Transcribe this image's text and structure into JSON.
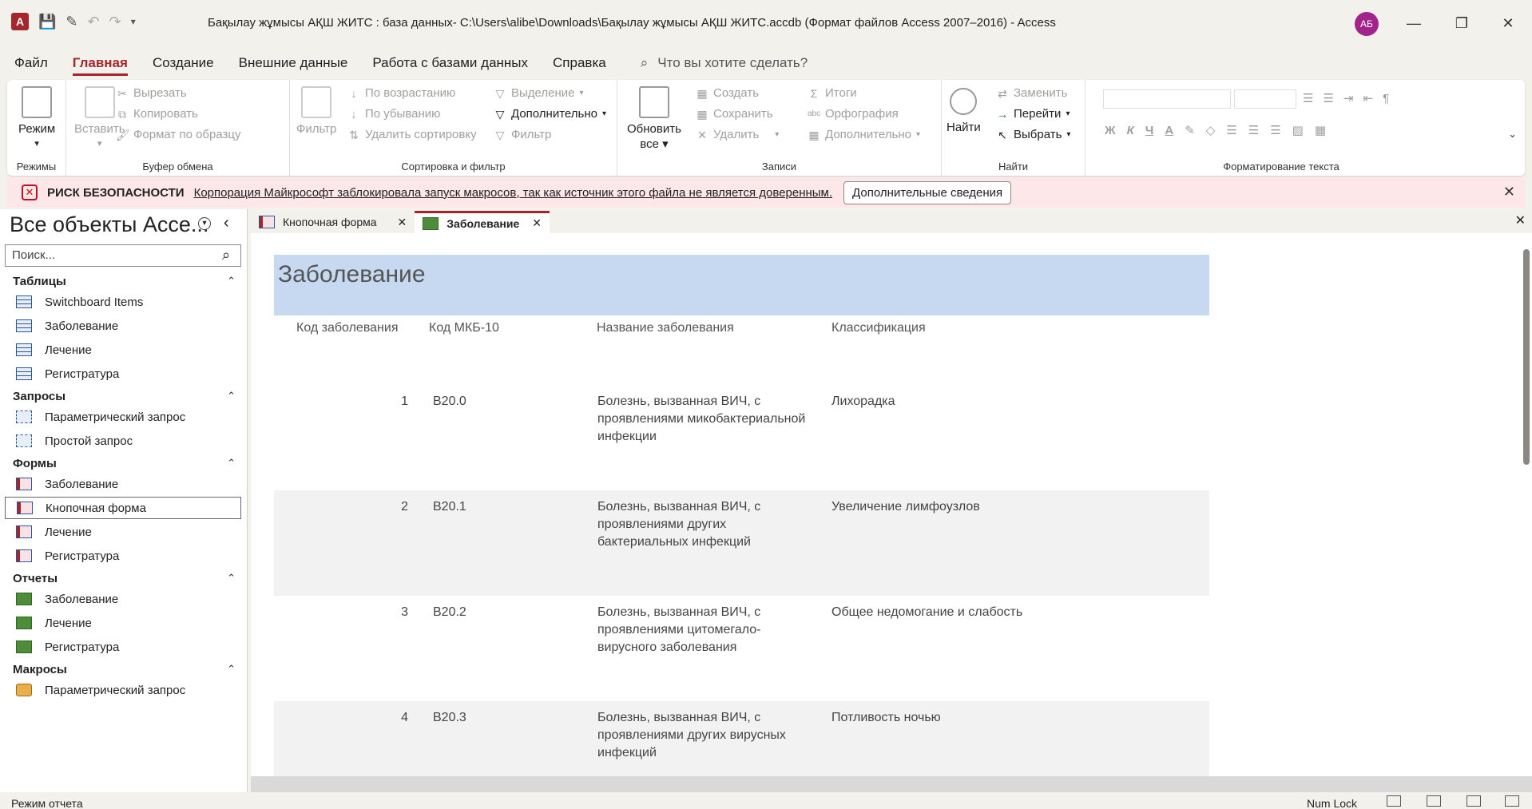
{
  "titlebar": {
    "title": "Бақылау жұмысы АҚШ ЖИТС : база данных- C:\\Users\\alibe\\Downloads\\Бақылау жұмысы АҚШ ЖИТС.accdb (Формат файлов Access 2007–2016)  -  Access",
    "app_letter": "A",
    "avatar": "АБ"
  },
  "menu": {
    "tabs": [
      "Файл",
      "Главная",
      "Создание",
      "Внешние данные",
      "Работа с базами данных",
      "Справка"
    ],
    "tellme": "Что вы хотите сделать?"
  },
  "ribbon": {
    "views": {
      "btn": "Режим",
      "label": "Режимы"
    },
    "clipboard": {
      "paste": "Вставить",
      "cut": "Вырезать",
      "copy": "Копировать",
      "format": "Формат по образцу",
      "label": "Буфер обмена"
    },
    "sort": {
      "filter": "Фильтр",
      "asc": "По возрастанию",
      "desc": "По убыванию",
      "remove": "Удалить сортировку",
      "selection": "Выделение",
      "advanced": "Дополнительно",
      "toggle": "Фильтр",
      "label": "Сортировка и фильтр"
    },
    "records": {
      "refresh1": "Обновить",
      "refresh2": "все",
      "new": "Создать",
      "save": "Сохранить",
      "delete": "Удалить",
      "totals": "Итоги",
      "spelling": "Орфография",
      "more": "Дополнительно",
      "label": "Записи"
    },
    "find": {
      "find": "Найти",
      "replace": "Заменить",
      "goto": "Перейти",
      "select": "Выбрать",
      "label": "Найти"
    },
    "textfmt": {
      "bold": "Ж",
      "italic": "К",
      "underline": "Ч",
      "fontcolor": "А",
      "label": "Форматирование текста"
    }
  },
  "security": {
    "title": "РИСК БЕЗОПАСНОСТИ",
    "message": "Корпорация Майкрософт заблокировала запуск макросов, так как источник этого файла не является доверенным.",
    "button": "Дополнительные сведения"
  },
  "nav": {
    "title": "Все объекты Acce...",
    "search_placeholder": "Поиск...",
    "sections": {
      "tables": {
        "title": "Таблицы",
        "items": [
          "Switchboard Items",
          "Заболевание",
          "Лечение",
          "Регистратура"
        ]
      },
      "queries": {
        "title": "Запросы",
        "items": [
          "Параметрический запрос",
          "Простой запрос"
        ]
      },
      "forms": {
        "title": "Формы",
        "items": [
          "Заболевание",
          "Кнопочная форма",
          "Лечение",
          "Регистратура"
        ]
      },
      "reports": {
        "title": "Отчеты",
        "items": [
          "Заболевание",
          "Лечение",
          "Регистратура"
        ]
      },
      "macros": {
        "title": "Макросы",
        "items": [
          "Параметрический запрос"
        ]
      }
    }
  },
  "doctabs": [
    "Кнопочная форма",
    "Заболевание"
  ],
  "report": {
    "title": "Заболевание",
    "columns": [
      "Код заболевания",
      "Код МКБ-10",
      "Название заболевания",
      "Классификация"
    ],
    "rows": [
      {
        "id": "1",
        "code": "B20.0",
        "name_lines": [
          "Болезнь, вызванная ВИЧ, с",
          "проявлениями микобактериальной",
          "инфекции"
        ],
        "cls": "Лихорадка"
      },
      {
        "id": "2",
        "code": "B20.1",
        "name_lines": [
          "Болезнь, вызванная ВИЧ, с",
          "проявлениями других",
          "бактериальных инфекций"
        ],
        "cls": "Увеличение лимфоузлов"
      },
      {
        "id": "3",
        "code": "B20.2",
        "name_lines": [
          "Болезнь, вызванная ВИЧ, с",
          "проявлениями цитомегало-",
          "вирусного заболевания"
        ],
        "cls": "Общее недомогание и слабость"
      },
      {
        "id": "4",
        "code": "B20.3",
        "name_lines": [
          "Болезнь, вызванная ВИЧ, с",
          "проявлениями других вирусных",
          "инфекций"
        ],
        "cls": "Потливость ночью"
      }
    ]
  },
  "status": {
    "mode": "Режим отчета",
    "numlock": "Num Lock"
  }
}
